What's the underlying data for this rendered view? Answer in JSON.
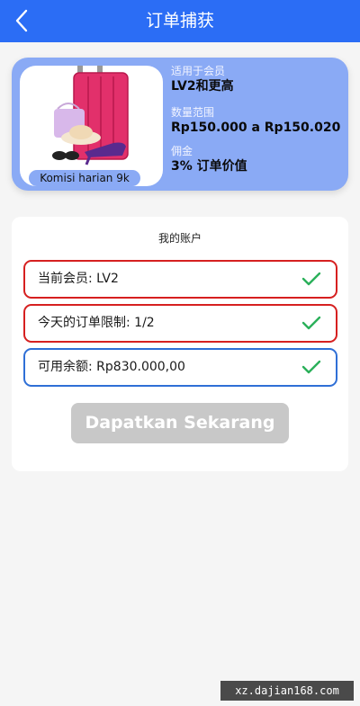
{
  "header": {
    "title": "订单捕获"
  },
  "product": {
    "commission_badge": "Komisi harian 9k",
    "level_label": "适用于会员",
    "level_value": "LV2和更高",
    "range_label": "数量范围",
    "range_value": "Rp150.000 a Rp150.020",
    "commission_label": "佣金",
    "commission_value": "3% 订单价值"
  },
  "account": {
    "title": "我的账户",
    "rows": [
      {
        "text": "当前会员: LV2",
        "status": "ok"
      },
      {
        "text": "今天的订单限制: 1/2",
        "status": "ok"
      },
      {
        "text": "可用余额: Rp830.000,00",
        "status": "ok"
      }
    ],
    "button_label": "Dapatkan Sekarang"
  },
  "watermark": "xz.dajian168.com",
  "colors": {
    "header_bg": "#2b6df5",
    "card_bg": "#8aaaf5",
    "row_border_red": "#d62020",
    "row_border_blue": "#2f6fd6",
    "check_green": "#2bb05a",
    "button_disabled": "#c8c8c8"
  }
}
